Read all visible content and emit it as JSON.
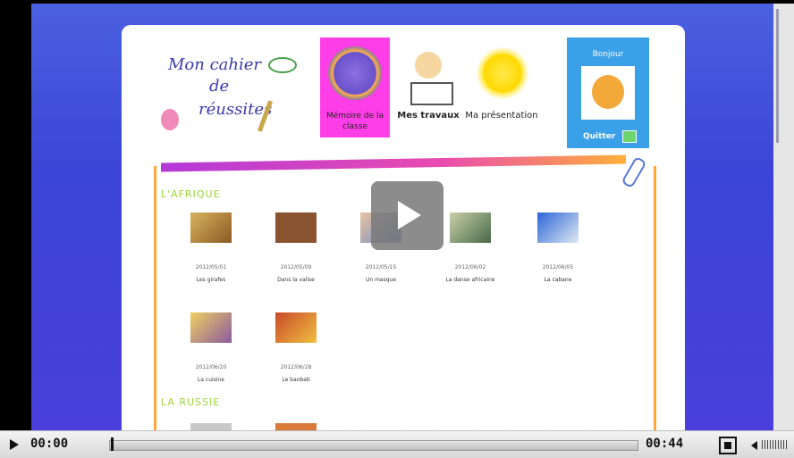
{
  "header": {
    "logo_line1": "Mon cahier",
    "logo_line2": "de",
    "logo_line3": "réussites",
    "nav": [
      {
        "label": "Mémoire de la classe"
      },
      {
        "label": "Mes travaux"
      },
      {
        "label": "Ma présentation"
      }
    ],
    "user_greeting": "Bonjour",
    "quit_label": "Quitter"
  },
  "sections": [
    {
      "title": "L'AFRIQUE"
    },
    {
      "title": "LA RUSSIE"
    }
  ],
  "items": [
    {
      "date": "2012/05/01",
      "caption": "Les girafes"
    },
    {
      "date": "2012/05/09",
      "caption": "Dans la valise"
    },
    {
      "date": "2012/05/15",
      "caption": "Un masque"
    },
    {
      "date": "2012/06/02",
      "caption": "La danse africaine"
    },
    {
      "date": "2012/06/05",
      "caption": "La cabane"
    },
    {
      "date": "2012/06/20",
      "caption": "La cuisine"
    },
    {
      "date": "2012/06/28",
      "caption": "Le baobab"
    }
  ],
  "player": {
    "current_time": "00:00",
    "total_time": "00:44",
    "progress": 0.0
  },
  "colors": {
    "accent_pink": "#ff3ee8",
    "section_green": "#9bd43a",
    "panel_orange": "#ffa63a",
    "background_blue": "#3a44d6"
  }
}
